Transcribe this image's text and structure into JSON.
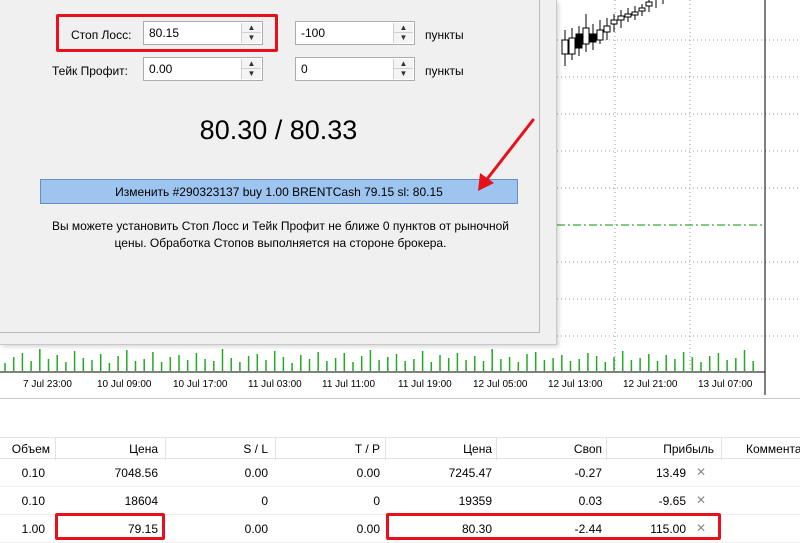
{
  "dialog": {
    "stop_loss_label": "Стоп Лосс:",
    "stop_loss_value": "80.15",
    "stop_loss_points": "-100",
    "take_profit_label": "Тейк Профит:",
    "take_profit_value": "0.00",
    "take_profit_points": "0",
    "points_label_1": "пункты",
    "points_label_2": "пункты",
    "price_display": "80.30 / 80.33",
    "modify_button": "Изменить #290323137 buy 1.00 BRENTCash 79.15 sl: 80.15",
    "hint_line1": "Вы можете установить Стоп Лосс и Тейк Профит не ближе 0 пунктов от рыночной",
    "hint_line2": "цены. Обработка Стопов выполняется на стороне брокера."
  },
  "time_axis": [
    "7 Jul 23:00",
    "10 Jul 09:00",
    "10 Jul 17:00",
    "11 Jul 03:00",
    "11 Jul 11:00",
    "11 Jul 19:00",
    "12 Jul 05:00",
    "12 Jul 13:00",
    "12 Jul 21:00",
    "13 Jul 07:00"
  ],
  "table": {
    "headers": {
      "volume": "Объем",
      "price": "Цена",
      "sl": "S / L",
      "tp": "T / P",
      "current_price": "Цена",
      "swap": "Своп",
      "profit": "Прибыль",
      "comment": "Коммента"
    },
    "rows": [
      {
        "volume": "0.10",
        "price": "7048.56",
        "sl": "0.00",
        "tp": "0.00",
        "current_price": "7245.47",
        "swap": "-0.27",
        "profit": "13.49"
      },
      {
        "volume": "0.10",
        "price": "18604",
        "sl": "0",
        "tp": "0",
        "current_price": "19359",
        "swap": "0.03",
        "profit": "-9.65"
      },
      {
        "volume": "1.00",
        "price": "79.15",
        "sl": "0.00",
        "tp": "0.00",
        "current_price": "80.30",
        "swap": "-2.44",
        "profit": "115.00"
      }
    ],
    "close_icon": "✕"
  },
  "colors": {
    "highlight_red": "#e8101a",
    "modify_button_bg": "#9ec4f0",
    "volume_green": "#22aa22",
    "level_line_green": "#109010"
  },
  "icons": {
    "spin_up": "spin-up-icon",
    "spin_down": "spin-down-icon",
    "close": "close-icon",
    "arrow": "annotation-arrow"
  }
}
